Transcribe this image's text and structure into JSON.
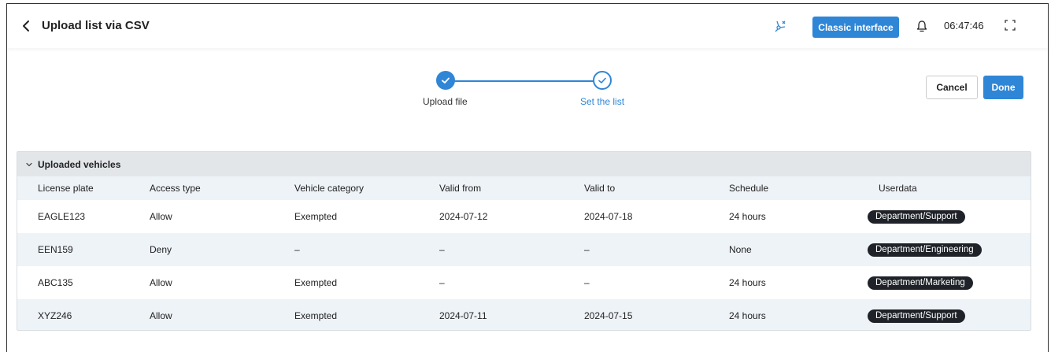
{
  "header": {
    "title": "Upload list via CSV",
    "classic_label": "Classic interface",
    "time": "06:47:46",
    "accent": "#2f86d6"
  },
  "stepper": {
    "steps": [
      {
        "label": "Upload file",
        "state": "done"
      },
      {
        "label": "Set the list",
        "state": "active"
      }
    ]
  },
  "actions": {
    "cancel": "Cancel",
    "done": "Done"
  },
  "section": {
    "title": "Uploaded vehicles",
    "columns": [
      "License plate",
      "Access type",
      "Vehicle category",
      "Valid from",
      "Valid to",
      "Schedule",
      "Userdata"
    ],
    "rows": [
      [
        "EAGLE123",
        "Allow",
        "Exempted",
        "2024-07-12",
        "2024-07-18",
        "24 hours",
        "Department/Support"
      ],
      [
        "EEN159",
        "Deny",
        "–",
        "–",
        "–",
        "None",
        "Department/Engineering"
      ],
      [
        "ABC135",
        "Allow",
        "Exempted",
        "–",
        "–",
        "24 hours",
        "Department/Marketing"
      ],
      [
        "XYZ246",
        "Allow",
        "Exempted",
        "2024-07-11",
        "2024-07-15",
        "24 hours",
        "Department/Support"
      ]
    ]
  },
  "icons": [
    "back-arrow-icon",
    "sparkle-fan-icon",
    "bell-icon",
    "fullscreen-icon",
    "check-icon",
    "chevron-down-icon"
  ]
}
